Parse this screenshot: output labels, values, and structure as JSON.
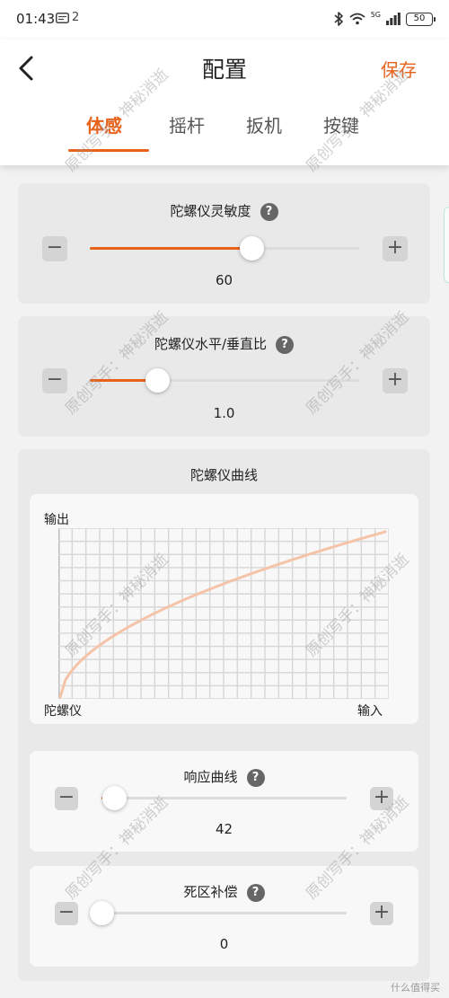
{
  "status_bar": {
    "time": "01:43",
    "notification_count": "2",
    "battery": "50",
    "network": "5G"
  },
  "header": {
    "title": "配置",
    "save_label": "保存"
  },
  "tabs": [
    {
      "label": "体感",
      "active": true
    },
    {
      "label": "摇杆",
      "active": false
    },
    {
      "label": "扳机",
      "active": false
    },
    {
      "label": "按键",
      "active": false
    }
  ],
  "gyro_sensitivity": {
    "label": "陀螺仪灵敏度",
    "value": "60",
    "fill_fraction": 0.6
  },
  "gyro_ratio": {
    "label": "陀螺仪水平/垂直比",
    "value": "1.0",
    "fill_fraction": 0.25
  },
  "gyro_curve": {
    "title": "陀螺仪曲线",
    "y_axis": "输出",
    "x_axis_left": "陀螺仪",
    "x_axis_right": "输入"
  },
  "response_curve": {
    "label": "响应曲线",
    "value": "42",
    "fill_fraction": 0.05
  },
  "deadzone": {
    "label": "死区补偿",
    "value": "0",
    "fill_fraction": 0.0
  },
  "decrease_symbol": "−",
  "increase_symbol": "+",
  "help_symbol": "?",
  "watermark": "原创写手：神秘消逝",
  "corner_logo": "什么值得买",
  "colors": {
    "accent": "#e8621a",
    "curve": "#f5c3a8",
    "card": "#e9e9e9"
  }
}
